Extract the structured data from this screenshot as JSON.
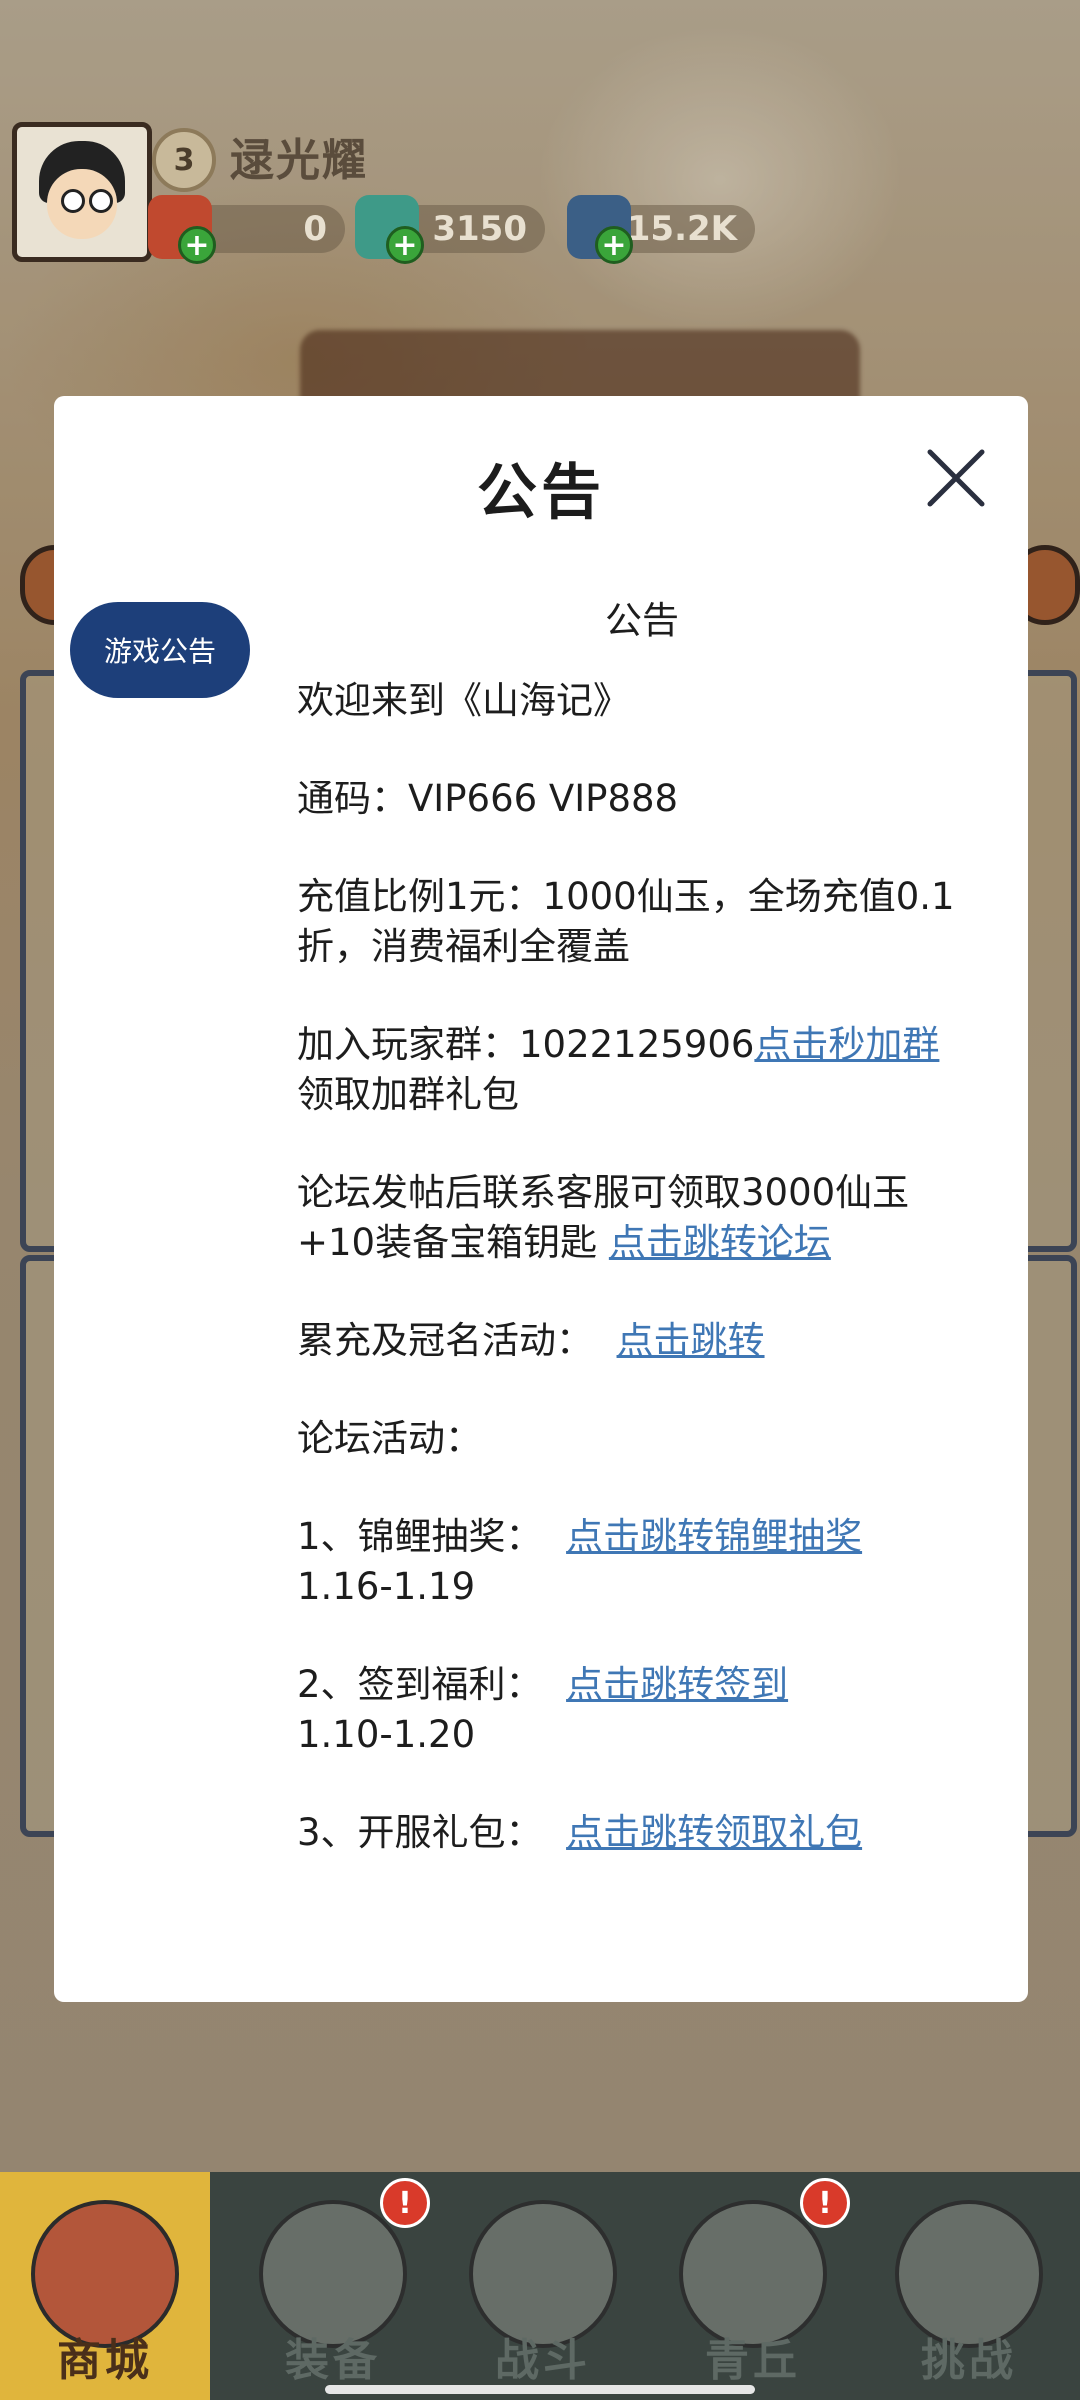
{
  "player": {
    "level": "3",
    "name": "逯光耀",
    "resources": [
      {
        "icon": "red-packet-icon",
        "value": "0"
      },
      {
        "icon": "jade-dragon-icon",
        "value": "3150"
      },
      {
        "icon": "crystal-icon",
        "value": "15.2K"
      }
    ]
  },
  "modal": {
    "title": "公告",
    "tab_label": "游戏公告",
    "heading": "公告",
    "welcome": "欢迎来到《山海记》",
    "codes": "通码：VIP666 VIP888",
    "recharge": "充值比例1元：1000仙玉，全场充值0.1折，消费福利全覆盖",
    "group_prefix": "加入玩家群：1022125906",
    "group_link": "点击秒加群",
    "group_suffix": " 领取加群礼包",
    "forum_text": "论坛发帖后联系客服可领取3000仙玉+10装备宝箱钥匙",
    "forum_link": "点击跳转论坛",
    "cumulative_text": "累充及冠名活动：",
    "cumulative_link": "点击跳转",
    "forum_activity": "论坛活动：",
    "activity1_text": "1、锦鲤抽奖：",
    "activity1_link": "点击跳转锦鲤抽奖",
    "activity1_date": "1.16-1.19",
    "activity2_text": "2、签到福利：",
    "activity2_link": "点击跳转签到",
    "activity2_date": "1.10-1.20",
    "activity3_text": "3、开服礼包：",
    "activity3_link": "点击跳转领取礼包"
  },
  "bottom_nav": [
    {
      "label": "商城",
      "icon": "shop-icon",
      "active": true,
      "badge": ""
    },
    {
      "label": "装备",
      "icon": "armor-icon",
      "active": false,
      "badge": "!"
    },
    {
      "label": "战斗",
      "icon": "crossed-swords-icon",
      "active": false,
      "badge": ""
    },
    {
      "label": "青丘",
      "icon": "mountain-icon",
      "active": false,
      "badge": "!"
    },
    {
      "label": "挑战",
      "icon": "challenge-orb-icon",
      "active": false,
      "badge": ""
    }
  ],
  "colors": {
    "link": "#3f77b5",
    "tab": "#1d3f7a",
    "nav_active": "#e0b53c"
  }
}
